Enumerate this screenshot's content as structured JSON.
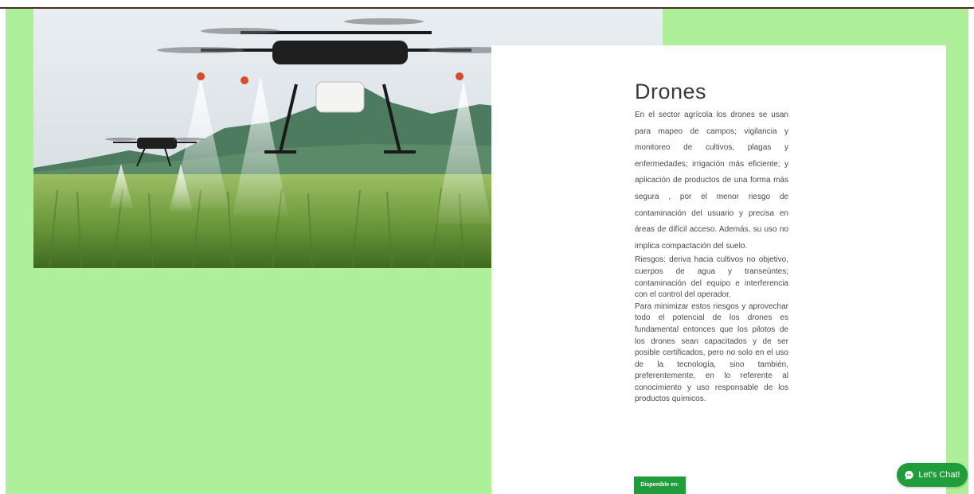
{
  "section": {
    "title": "Drones",
    "paragraphs": [
      "En el sector agrícola los drones se usan para mapeo de campos; vigilancia y monitoreo de cultivos, plagas y enfermedades; irrigación más eficiente; y aplicación de productos de una forma más segura , por el menor riesgo de contaminación del usuario y precisa en áreas de difícil acceso. Además, su uso no implica compactación del suelo.",
      "Riesgos: deriva hacia cultivos no objetivo, cuerpos de agua y transeúntes; contaminación del equipo e interferencia con el control del operador.",
      "Para minimizar estos riesgos y aprovechar todo el potencial de los drones es fundamental entonces que los pilotos de los drones sean capacitados y de ser posible certificados, pero no solo en el uso de la tecnología, sino también, preferentemente, en lo referente al conocimiento y uso responsable de los productos químicos."
    ],
    "cta_label": "Disponible en:"
  },
  "chat": {
    "label": "Let's Chat!",
    "icon": "chat-bubble-icon"
  },
  "hero": {
    "icon": "agricultural-drones-image"
  },
  "colors": {
    "background": "#aeef9a",
    "accent": "#1f9d3a",
    "top_line": "#4a2b1c",
    "card": "#ffffff"
  }
}
